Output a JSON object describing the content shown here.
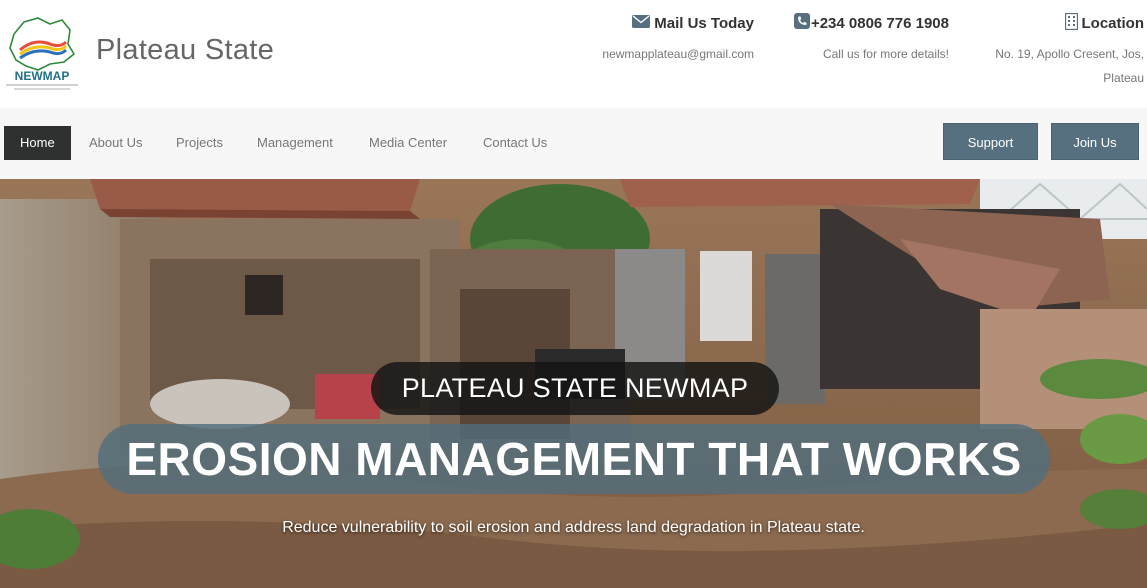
{
  "header": {
    "logo_text": "NEWMAP",
    "site_title": "Plateau State",
    "contacts": {
      "mail": {
        "icon": "envelope-icon",
        "title": "Mail Us Today",
        "sub": "newmapplateau@gmail.com"
      },
      "phone": {
        "icon": "phone-icon",
        "title": "+234 0806 776 1908",
        "sub": "Call us for more details!"
      },
      "location": {
        "icon": "building-icon",
        "title": "Location",
        "sub_line1": "No. 19, Apollo Cresent, Jos,",
        "sub_line2": "Plateau"
      }
    }
  },
  "nav": {
    "items": [
      {
        "label": "Home",
        "active": true
      },
      {
        "label": "About Us"
      },
      {
        "label": "Projects"
      },
      {
        "label": "Management"
      },
      {
        "label": "Media Center"
      },
      {
        "label": "Contact Us"
      }
    ],
    "support_label": "Support",
    "join_label": "Join Us"
  },
  "hero": {
    "kicker": "PLATEAU STATE NEWMAP",
    "headline": "EROSION MANAGEMENT THAT WORKS",
    "tagline": "Reduce vulnerability to soil erosion and address land degradation in Plateau state."
  },
  "colors": {
    "nav_active_bg": "#2f3030",
    "button_bg": "#577080",
    "headline_bg": "#526e7d"
  }
}
